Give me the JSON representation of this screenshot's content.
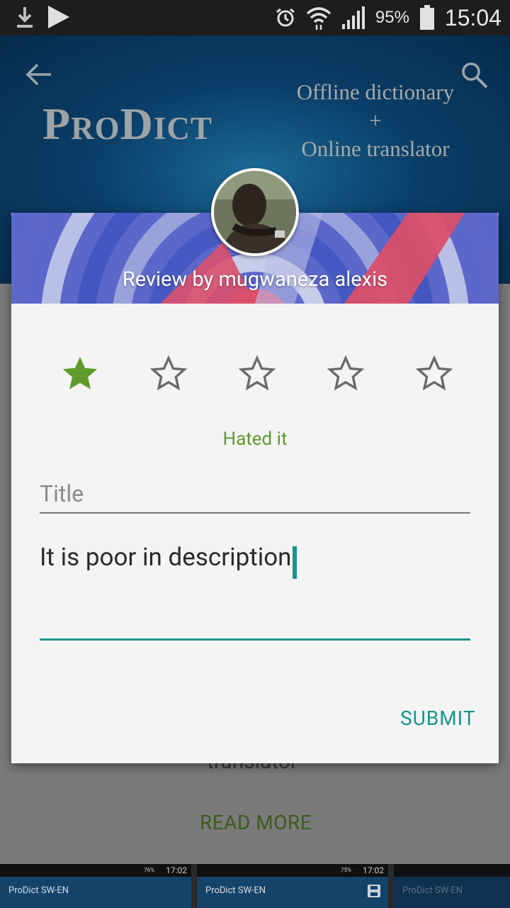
{
  "status_bar": {
    "battery_pct": "95%",
    "time": "15:04"
  },
  "header": {
    "logo": "ProDict",
    "tagline_line1": "Offline dictionary",
    "tagline_plus": "+",
    "tagline_line2": "Online translator"
  },
  "background": {
    "partial_text": "translator",
    "read_more": "READ MORE"
  },
  "dialog": {
    "title": "Review by mugwaneza alexis",
    "rating": 1,
    "rating_max": 5,
    "rating_label": "Hated it",
    "title_placeholder": "Title",
    "description_value": "It is poor in description",
    "submit_label": "SUBMIT",
    "accent_color": "#17968a",
    "star_color": "#5f9b2b"
  },
  "recents": [
    {
      "title": "ProDict SW-EN",
      "time": "17:02",
      "battery_pct": "76%"
    },
    {
      "title": "ProDict SW-EN",
      "time": "17:02",
      "battery_pct": "75%"
    },
    {
      "title": "ProDict SW-EN"
    }
  ]
}
